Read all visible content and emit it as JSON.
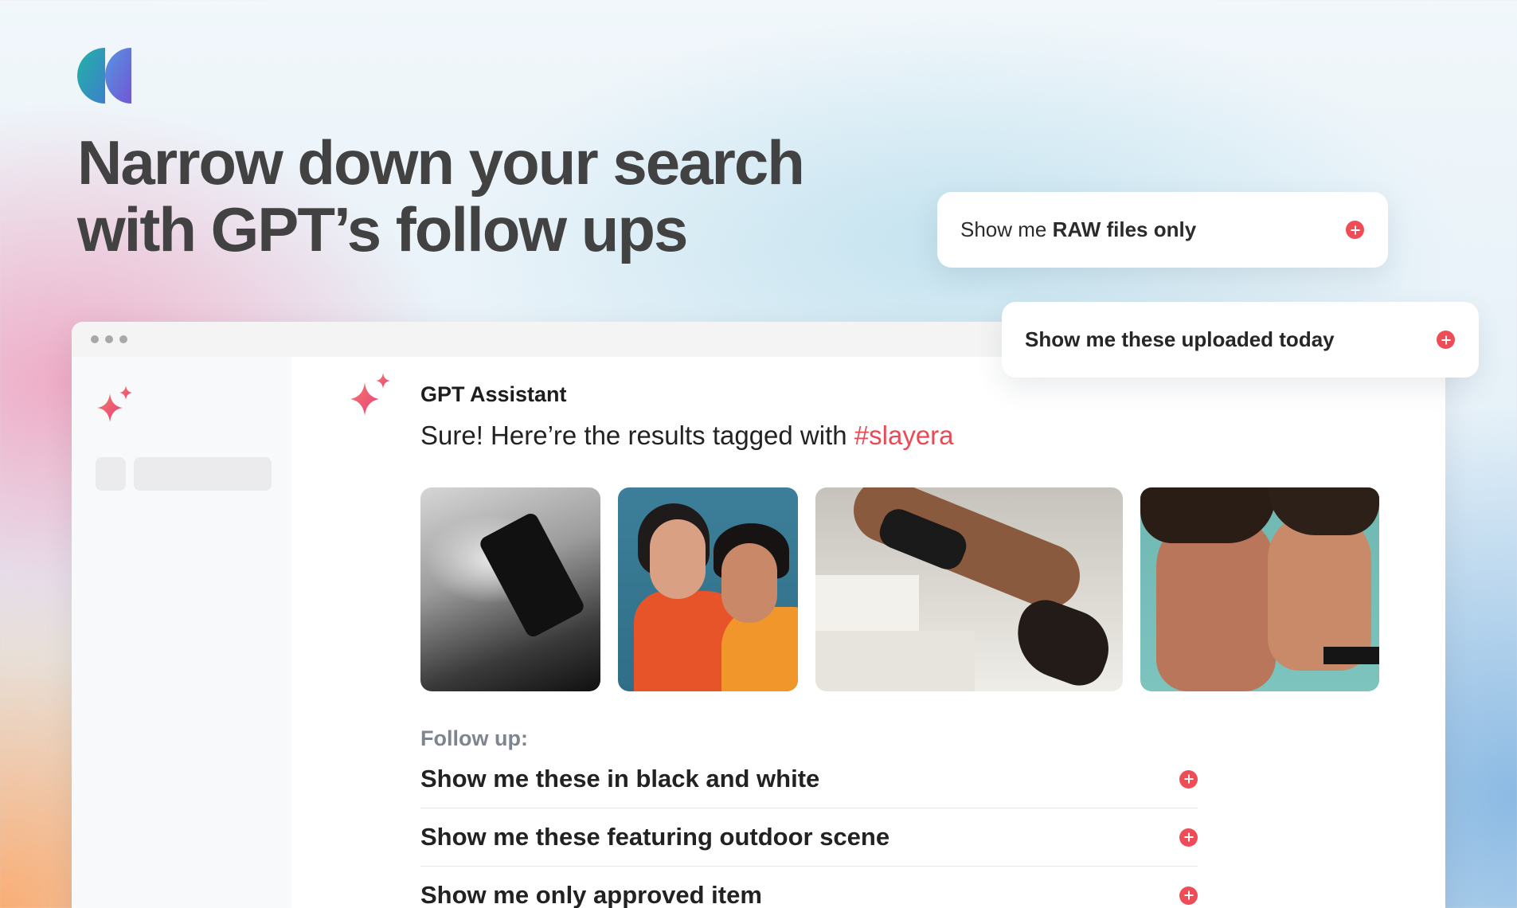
{
  "headline": {
    "line1": "Narrow down your search",
    "line2": "with GPT’s follow ups"
  },
  "floating_cards": [
    {
      "prefix": "Show me ",
      "bold": "RAW files only"
    },
    {
      "label": "Show me these uploaded today"
    }
  ],
  "chat": {
    "sender": "GPT Assistant",
    "reply_text": "Sure! Here’re the results tagged with ",
    "reply_tag": "#slayera"
  },
  "follow_up": {
    "label": "Follow up:",
    "items": [
      "Show me these in black and white",
      "Show me these featuring outdoor scene",
      "Show me only approved item"
    ]
  },
  "colors": {
    "accent": "#ee4c57",
    "tag": "#ea4a56",
    "heading": "#424242",
    "muted": "#7e8590"
  },
  "icons": {
    "logo": "brand-logo-icon",
    "sparkle": "sparkle-icon",
    "add": "plus-circle-icon"
  }
}
